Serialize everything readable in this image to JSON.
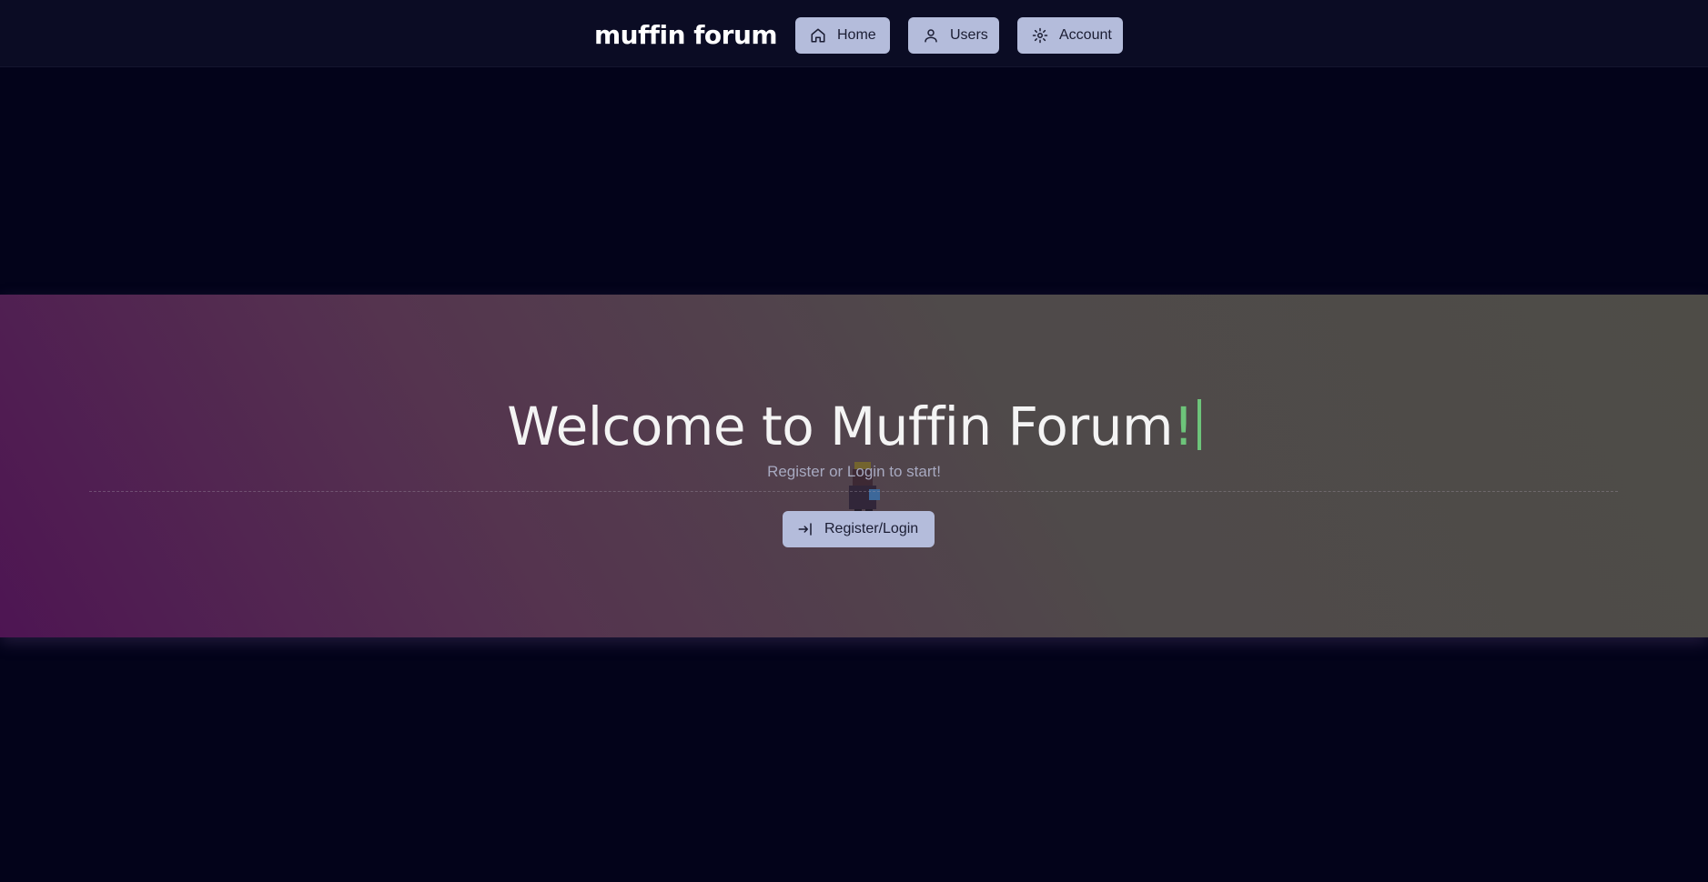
{
  "header": {
    "logo": "muffin forum",
    "nav": [
      {
        "label": "Home",
        "icon": "home-icon"
      },
      {
        "label": "Users",
        "icon": "user-icon"
      },
      {
        "label": "Account",
        "icon": "gear-icon"
      }
    ]
  },
  "hero": {
    "title_main": "Welcome to Muffin Forum",
    "title_accent": "!",
    "subtitle": "Register or Login to start!",
    "cta_label": "Register/Login",
    "cta_icon": "login-icon"
  },
  "colors": {
    "background": "#03031a",
    "header": "#0b0c24",
    "button": "#b4bcdb",
    "accent": "#6dc47a"
  }
}
